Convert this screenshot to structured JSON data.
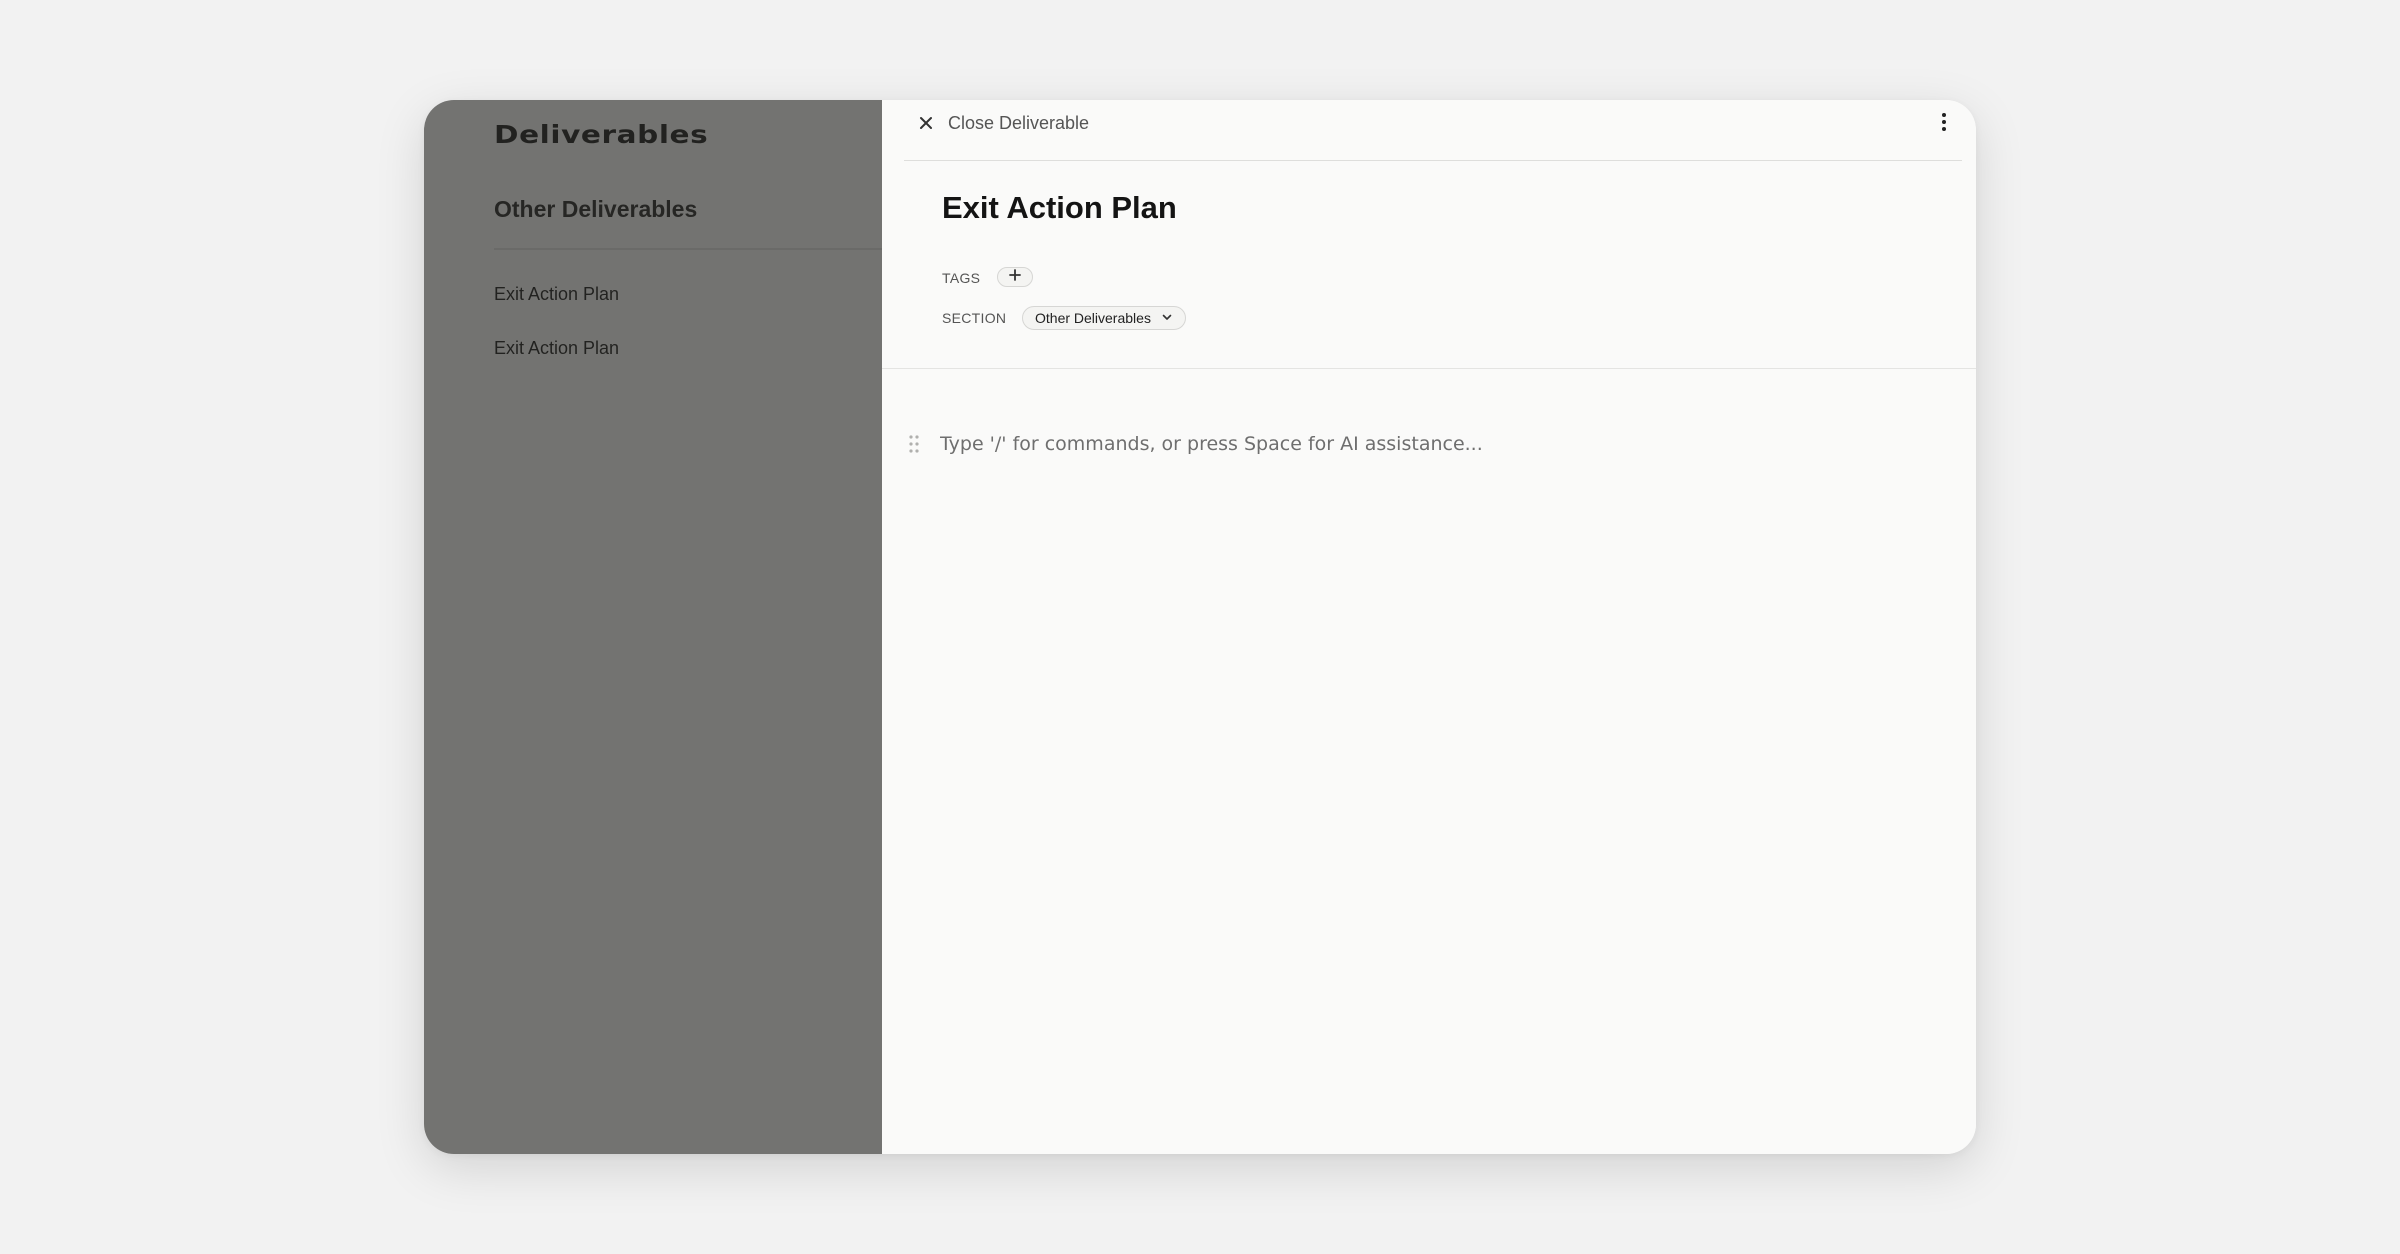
{
  "sidebar": {
    "title": "Deliverables",
    "section_heading": "Other Deliverables",
    "items": [
      {
        "label": "Exit Action Plan"
      },
      {
        "label": "Exit Action Plan"
      }
    ]
  },
  "panel": {
    "close_label": "Close Deliverable",
    "close_icon": "close-icon",
    "more_icon": "more-vertical-icon",
    "title": "Exit Action Plan",
    "tags_label": "TAGS",
    "add_tag_icon": "plus-icon",
    "section_label": "SECTION",
    "section_value": "Other Deliverables",
    "section_dropdown_icon": "chevron-down-icon",
    "editor_placeholder": "Type '/' for commands, or press Space for AI assistance...",
    "drag_handle_icon": "drag-handle-icon"
  },
  "colors": {
    "page_background": "#f2f2f2",
    "panel_background": "#fafaf9",
    "overlay": "#6f6f6c"
  }
}
